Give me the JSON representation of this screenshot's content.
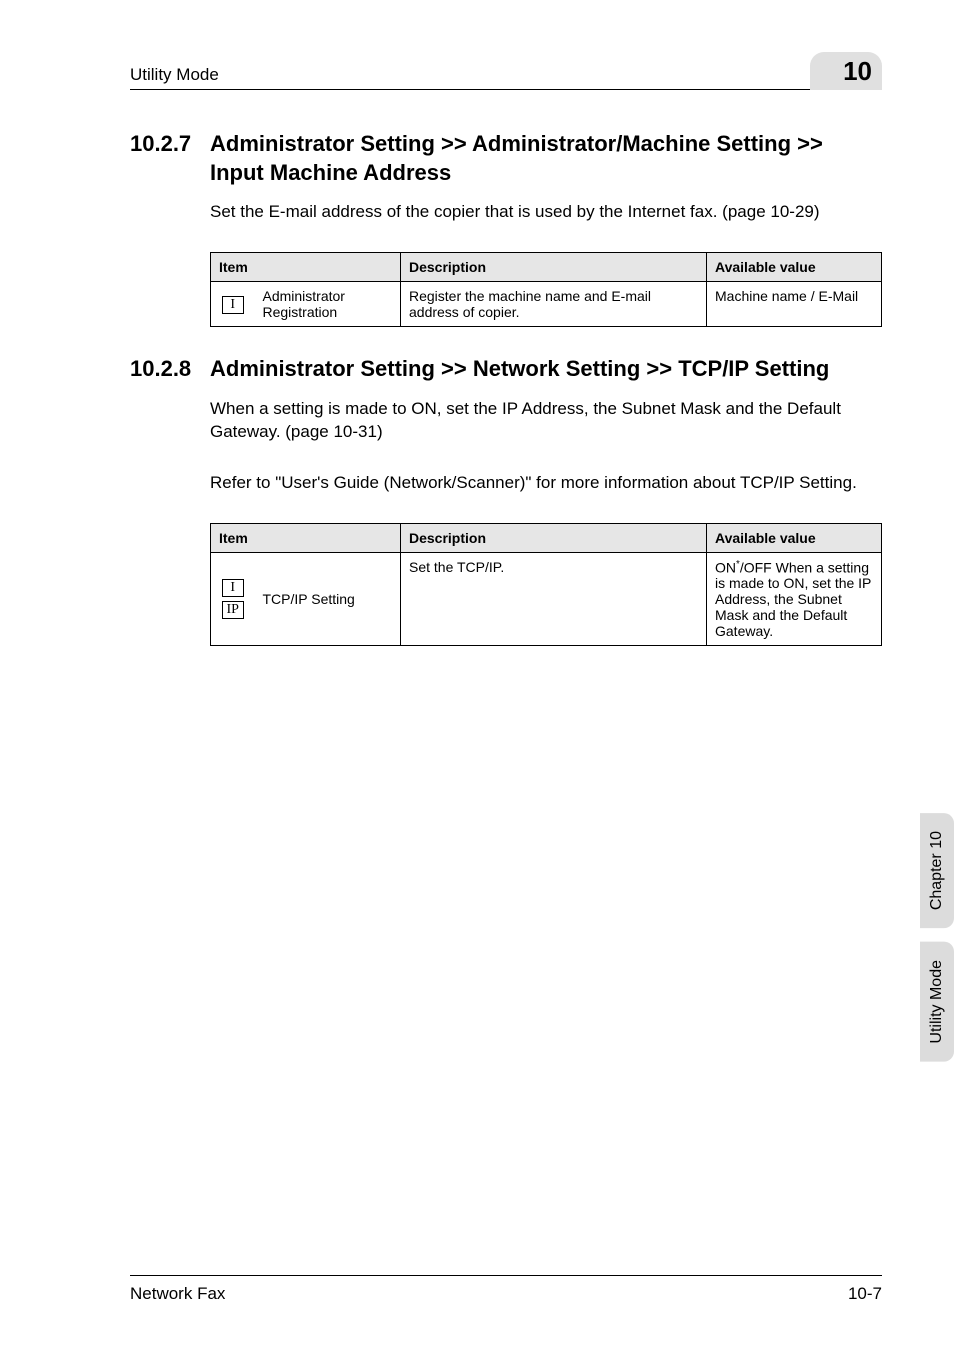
{
  "header": {
    "section_name": "Utility Mode",
    "chapter_badge": "10"
  },
  "sections": [
    {
      "number": "10.2.7",
      "title": "Administrator Setting >> Administrator/Machine Setting >> Input Machine Address",
      "paragraphs": [
        "Set the E-mail address of the copier that is used by the Internet fax. (page 10-29)"
      ],
      "table": {
        "headers": {
          "item": "Item",
          "description": "Description",
          "available": "Available value"
        },
        "rows": [
          {
            "icons": [
              "I"
            ],
            "label": "Administrator Registration",
            "description": "Register the machine name and E-mail address of copier.",
            "available": "Machine name / E-Mail"
          }
        ]
      }
    },
    {
      "number": "10.2.8",
      "title": "Administrator Setting >> Network Setting >> TCP/IP Setting",
      "paragraphs": [
        "When a setting is made to ON, set the IP Address, the Subnet Mask and the Default Gateway. (page 10-31)",
        "Refer to \"User's Guide (Network/Scanner)\" for more information about TCP/IP Setting."
      ],
      "table": {
        "headers": {
          "item": "Item",
          "description": "Description",
          "available": "Available value"
        },
        "rows": [
          {
            "icons": [
              "I",
              "IP"
            ],
            "label": "TCP/IP Setting",
            "description": "Set the TCP/IP.",
            "available_prefix": "ON",
            "available_sup": "*",
            "available_suffix": "/OFF\nWhen a setting is made to ON, set the IP Address, the Subnet Mask and the Default Gateway."
          }
        ]
      }
    }
  ],
  "side_tabs": {
    "top": "Chapter 10",
    "bottom": "Utility Mode"
  },
  "footer": {
    "left": "Network Fax",
    "right": "10-7"
  }
}
